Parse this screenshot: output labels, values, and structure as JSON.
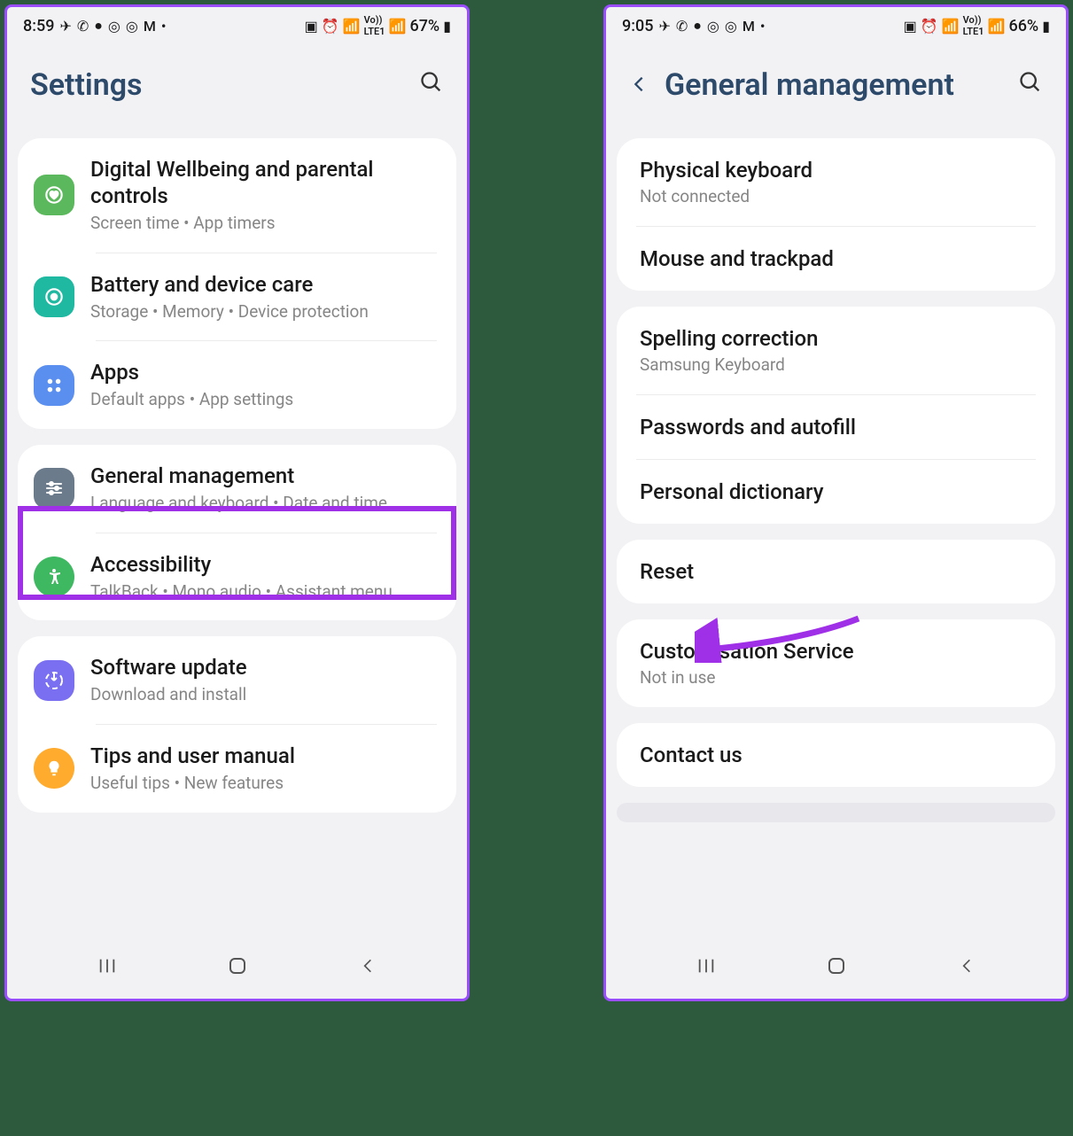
{
  "left": {
    "status": {
      "time": "8:59",
      "battery": "67%"
    },
    "header": {
      "title": "Settings"
    },
    "group1": [
      {
        "title": "Digital Wellbeing and parental controls",
        "sub": "Screen time  •  App timers"
      },
      {
        "title": "Battery and device care",
        "sub": "Storage  •  Memory  •  Device protection"
      },
      {
        "title": "Apps",
        "sub": "Default apps  •  App settings"
      }
    ],
    "group2": [
      {
        "title": "General management",
        "sub": "Language and keyboard  •  Date and time"
      },
      {
        "title": "Accessibility",
        "sub": "TalkBack  •  Mono audio  •  Assistant menu"
      }
    ],
    "group3": [
      {
        "title": "Software update",
        "sub": "Download and install"
      },
      {
        "title": "Tips and user manual",
        "sub": "Useful tips  •  New features"
      }
    ]
  },
  "right": {
    "status": {
      "time": "9:05",
      "battery": "66%"
    },
    "header": {
      "title": "General management"
    },
    "group1": [
      {
        "title": "Physical keyboard",
        "sub": "Not connected"
      },
      {
        "title": "Mouse and trackpad"
      }
    ],
    "group2": [
      {
        "title": "Spelling correction",
        "sub": "Samsung Keyboard"
      },
      {
        "title": "Passwords and autofill"
      },
      {
        "title": "Personal dictionary"
      }
    ],
    "group3": [
      {
        "title": "Reset"
      }
    ],
    "group4": [
      {
        "title": "Customisation Service",
        "sub": "Not in use"
      }
    ],
    "group5": [
      {
        "title": "Contact us"
      }
    ]
  }
}
